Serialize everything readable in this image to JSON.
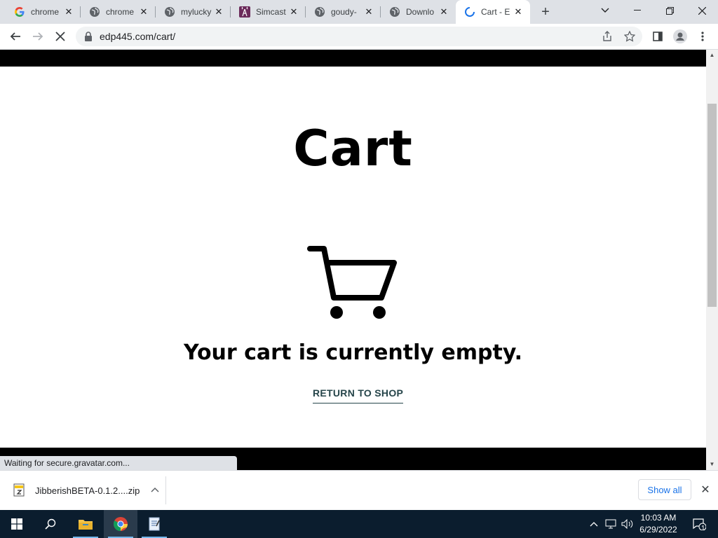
{
  "tabs": [
    {
      "title": "chrome",
      "icon": "google-icon"
    },
    {
      "title": "chrome",
      "icon": "globe-icon"
    },
    {
      "title": "mylucky",
      "icon": "globe-icon"
    },
    {
      "title": "Simcast",
      "icon": "tower-icon"
    },
    {
      "title": "goudy-",
      "icon": "globe-icon"
    },
    {
      "title": "Downlo",
      "icon": "globe-icon"
    },
    {
      "title": "Cart - E",
      "icon": "loading-icon",
      "active": true
    }
  ],
  "address_bar": {
    "url": "edp445.com/cart/"
  },
  "page": {
    "heading": "Cart",
    "empty_message": "Your cart is currently empty.",
    "return_link": "RETURN TO SHOP",
    "status_text": "Waiting for secure.gravatar.com..."
  },
  "downloads": {
    "file_name": "JibberishBETA-0.1.2....zip",
    "show_all_label": "Show all"
  },
  "taskbar": {
    "time": "10:03 AM",
    "date": "6/29/2022",
    "notification_count": "1"
  },
  "colors": {
    "link": "#26454a",
    "band": "#000000",
    "tabstrip": "#dee1e6",
    "taskbar": "#0b1d2e"
  }
}
